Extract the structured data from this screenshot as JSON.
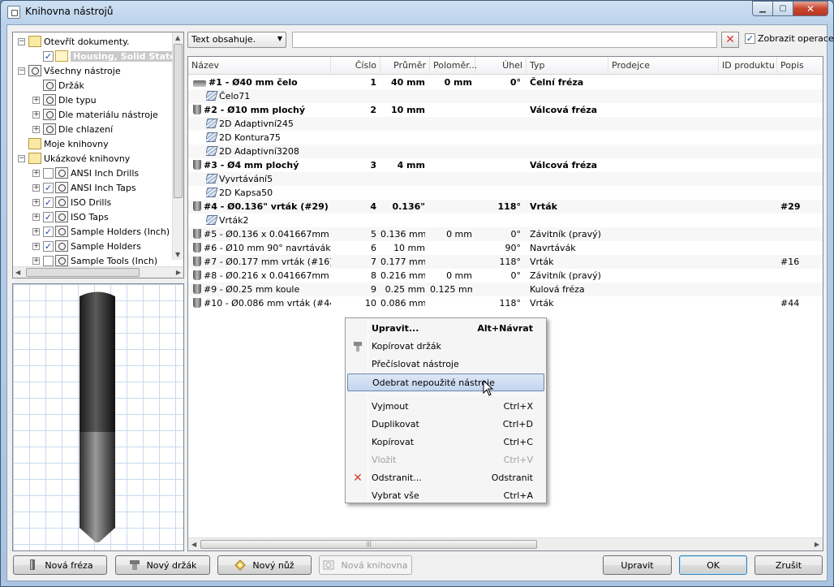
{
  "window": {
    "title": "Knihovna nástrojů"
  },
  "tree": {
    "items": [
      {
        "label": "Otevřít dokumenty.",
        "level": 0,
        "expander": "−",
        "icon": "folder-open-icon"
      },
      {
        "label": "Housing, Solid State",
        "level": 1,
        "checked": true,
        "icon": "document-icon",
        "selected": true
      },
      {
        "label": "Všechny nástroje",
        "level": 0,
        "expander": "−",
        "icon": "library-icon"
      },
      {
        "label": "Držák",
        "level": 1,
        "icon": "library-icon"
      },
      {
        "label": "Dle typu",
        "level": 1,
        "expander": "+",
        "icon": "library-icon"
      },
      {
        "label": "Dle materiálu nástroje",
        "level": 1,
        "expander": "+",
        "icon": "library-icon"
      },
      {
        "label": "Dle chlazení",
        "level": 1,
        "expander": "+",
        "icon": "library-icon"
      },
      {
        "label": "Moje knihovny",
        "level": 0,
        "icon": "folder-icon"
      },
      {
        "label": "Ukázkové knihovny",
        "level": 0,
        "expander": "−",
        "icon": "folder-icon"
      },
      {
        "label": "ANSI Inch Drills",
        "level": 1,
        "expander": "+",
        "checked": false,
        "icon": "library-icon"
      },
      {
        "label": "ANSI Inch Taps",
        "level": 1,
        "expander": "+",
        "checked": true,
        "icon": "library-icon"
      },
      {
        "label": "ISO Drills",
        "level": 1,
        "expander": "+",
        "checked": true,
        "icon": "library-icon"
      },
      {
        "label": "ISO Taps",
        "level": 1,
        "expander": "+",
        "checked": true,
        "icon": "library-icon"
      },
      {
        "label": "Sample Holders (Inch)",
        "level": 1,
        "expander": "+",
        "checked": true,
        "icon": "library-icon"
      },
      {
        "label": "Sample Holders",
        "level": 1,
        "expander": "+",
        "checked": true,
        "icon": "library-icon"
      },
      {
        "label": "Sample Tools (Inch)",
        "level": 1,
        "expander": "+",
        "checked": false,
        "icon": "library-icon"
      }
    ]
  },
  "search": {
    "filter_label": "Text obsahuje.",
    "value": "",
    "show_ops_label": "Zobrazit operace",
    "show_ops_checked": true
  },
  "grid": {
    "columns": [
      "Název",
      "Číslo",
      "Průměr",
      "Poloměr...",
      "Úhel",
      "Typ",
      "Prodejce",
      "ID produktu",
      "Popis"
    ],
    "rows": [
      {
        "kind": "tool",
        "bold": true,
        "icon": "face-mill-icon",
        "name": "#1 - Ø40 mm čelo",
        "num": "1",
        "dia": "40 mm",
        "rad": "0 mm",
        "angle": "0°",
        "type": "Čelní fréza",
        "desc": ""
      },
      {
        "kind": "op",
        "name": "Čelo71"
      },
      {
        "kind": "tool",
        "bold": true,
        "icon": "flat-mill-icon",
        "name": "#2 - Ø10 mm plochý",
        "num": "2",
        "dia": "10 mm",
        "rad": "",
        "angle": "",
        "type": "Válcová fréza",
        "desc": ""
      },
      {
        "kind": "op",
        "name": "2D Adaptivní245"
      },
      {
        "kind": "op",
        "name": "2D Kontura75"
      },
      {
        "kind": "op",
        "name": "2D Adaptivní3208"
      },
      {
        "kind": "tool",
        "bold": true,
        "icon": "flat-mill-icon",
        "name": "#3 - Ø4 mm plochý",
        "num": "3",
        "dia": "4 mm",
        "rad": "",
        "angle": "",
        "type": "Válcová fréza",
        "desc": ""
      },
      {
        "kind": "op",
        "name": "Vyvrtávání5"
      },
      {
        "kind": "op",
        "name": "2D Kapsa50"
      },
      {
        "kind": "tool",
        "bold": true,
        "icon": "drill-icon",
        "name": "#4 - Ø0.136\" vrták (#29)",
        "num": "4",
        "dia": "0.136\"",
        "rad": "",
        "angle": "118°",
        "type": "Vrták",
        "desc": "#29"
      },
      {
        "kind": "op",
        "name": "Vrták2"
      },
      {
        "kind": "tool",
        "bold": false,
        "icon": "tap-icon",
        "name": "#5 - Ø0.136 x 0.041667mm ...",
        "num": "5",
        "dia": "0.136 mm",
        "rad": "0 mm",
        "angle": "0°",
        "type": "Závitník (pravý)",
        "desc": ""
      },
      {
        "kind": "tool",
        "bold": false,
        "icon": "spot-drill-icon",
        "name": "#6 - Ø10 mm 90° navrtávák",
        "num": "6",
        "dia": "10 mm",
        "rad": "",
        "angle": "90°",
        "type": "Navrtávák",
        "desc": ""
      },
      {
        "kind": "tool",
        "bold": false,
        "icon": "drill-icon",
        "name": "#7 - Ø0.177 mm vrták (#16)",
        "num": "7",
        "dia": "0.177 mm",
        "rad": "",
        "angle": "118°",
        "type": "Vrták",
        "desc": "#16"
      },
      {
        "kind": "tool",
        "bold": false,
        "icon": "tap-icon",
        "name": "#8 - Ø0.216 x 0.041667mm ...",
        "num": "8",
        "dia": "0.216 mm",
        "rad": "0 mm",
        "angle": "0°",
        "type": "Závitník (pravý)",
        "desc": ""
      },
      {
        "kind": "tool",
        "bold": false,
        "icon": "ball-mill-icon",
        "name": "#9 - Ø0.25 mm koule",
        "num": "9",
        "dia": "0.25 mm",
        "rad": "0.125 mm",
        "angle": "",
        "type": "Kulová fréza",
        "desc": ""
      },
      {
        "kind": "tool",
        "bold": false,
        "icon": "drill-icon",
        "name": "#10 - Ø0.086 mm vrták (#44)",
        "num": "10",
        "dia": "0.086 mm",
        "rad": "",
        "angle": "118°",
        "type": "Vrták",
        "desc": "#44"
      }
    ]
  },
  "context_menu": {
    "items": [
      {
        "label": "Upravit...",
        "shortcut": "Alt+Návrat",
        "bold": true
      },
      {
        "label": "Kopírovat držák",
        "shortcut": "",
        "icon": "holder-icon"
      },
      {
        "label": "Přečíslovat nástroje",
        "shortcut": ""
      },
      {
        "label": "Odebrat nepoužité nástroje",
        "shortcut": "",
        "highlighted": true
      },
      {
        "separator": true
      },
      {
        "label": "Vyjmout",
        "shortcut": "Ctrl+X"
      },
      {
        "label": "Duplikovat",
        "shortcut": "Ctrl+D"
      },
      {
        "label": "Kopírovat",
        "shortcut": "Ctrl+C"
      },
      {
        "label": "Vložit",
        "shortcut": "Ctrl+V",
        "disabled": true
      },
      {
        "label": "Odstranit...",
        "shortcut": "Odstranit",
        "icon": "delete-x-icon"
      },
      {
        "label": "Vybrat vše",
        "shortcut": "Ctrl+A"
      }
    ]
  },
  "buttons": {
    "new_mill": "Nová fréza",
    "new_holder": "Nový držák",
    "new_knife": "Nový nůž",
    "new_library": "Nová knihovna",
    "edit": "Upravit",
    "ok": "OK",
    "cancel": "Zrušit"
  },
  "colors": {
    "accent": "#3c7fb1",
    "delete_red": "#d33a2c",
    "selection": "#c3d5ef"
  }
}
